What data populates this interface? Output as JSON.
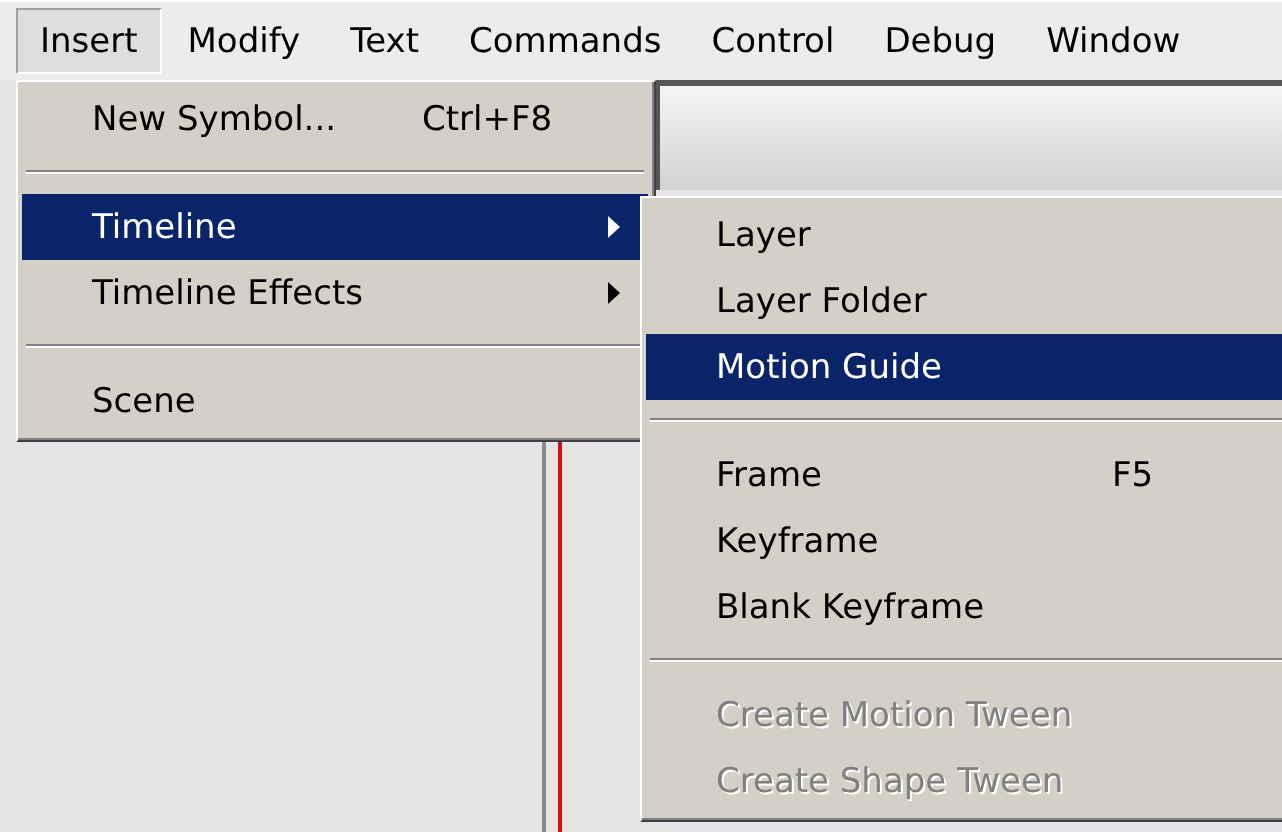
{
  "menubar": [
    {
      "label": "Insert",
      "selected": true
    },
    {
      "label": "Modify",
      "selected": false
    },
    {
      "label": "Text",
      "selected": false
    },
    {
      "label": "Commands",
      "selected": false
    },
    {
      "label": "Control",
      "selected": false
    },
    {
      "label": "Debug",
      "selected": false
    },
    {
      "label": "Window",
      "selected": false
    }
  ],
  "insert_menu": {
    "items": [
      {
        "kind": "item",
        "label": "New Symbol...",
        "shortcut": "Ctrl+F8",
        "selected": false,
        "disabled": false,
        "submenu": false
      },
      {
        "kind": "separator"
      },
      {
        "kind": "item",
        "label": "Timeline",
        "selected": true,
        "disabled": false,
        "submenu": true
      },
      {
        "kind": "item",
        "label": "Timeline Effects",
        "selected": false,
        "disabled": false,
        "submenu": true
      },
      {
        "kind": "separator"
      },
      {
        "kind": "item",
        "label": "Scene",
        "selected": false,
        "disabled": false,
        "submenu": false
      }
    ]
  },
  "timeline_submenu": {
    "items": [
      {
        "kind": "item",
        "label": "Layer",
        "selected": false,
        "disabled": false,
        "submenu": false
      },
      {
        "kind": "item",
        "label": "Layer Folder",
        "selected": false,
        "disabled": false,
        "submenu": false
      },
      {
        "kind": "item",
        "label": "Motion Guide",
        "selected": true,
        "disabled": false,
        "submenu": false
      },
      {
        "kind": "separator"
      },
      {
        "kind": "item",
        "label": "Frame",
        "shortcut": "F5",
        "selected": false,
        "disabled": false,
        "submenu": false
      },
      {
        "kind": "item",
        "label": "Keyframe",
        "selected": false,
        "disabled": false,
        "submenu": false
      },
      {
        "kind": "item",
        "label": "Blank Keyframe",
        "selected": false,
        "disabled": false,
        "submenu": false
      },
      {
        "kind": "separator"
      },
      {
        "kind": "item",
        "label": "Create Motion Tween",
        "selected": false,
        "disabled": true,
        "submenu": false
      },
      {
        "kind": "item",
        "label": "Create Shape Tween",
        "selected": false,
        "disabled": true,
        "submenu": false
      }
    ]
  }
}
